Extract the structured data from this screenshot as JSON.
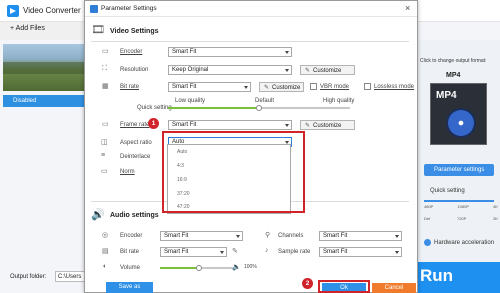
{
  "app": {
    "title": "Video Converter",
    "add_files": "+ Add Files",
    "track": "Disabled",
    "output_folder_label": "Output folder:",
    "output_path": "C:\\Users",
    "right_panel": {
      "hint": "Click to change output format:",
      "format": "MP4",
      "tile_label": "MP4",
      "param_button": "Parameter settings",
      "quick_setting": "Quick setting",
      "ticks_top": [
        "480P",
        "1080P",
        "4K"
      ],
      "ticks_bottom": [
        "Def",
        "720P",
        "2K"
      ],
      "hw_accel": "Hardware acceleration",
      "run": "Run"
    }
  },
  "dialog": {
    "title": "Parameter Settings",
    "close": "×",
    "video": {
      "section_title": "Video Settings",
      "encoder_label": "Encoder",
      "encoder_value": "Smart Fit",
      "resolution_label": "Resolution",
      "resolution_value": "Keep Original",
      "customize": "Customize",
      "bitrate_label": "Bit rate",
      "bitrate_value": "Smart Fit",
      "vbr_label": "VBR mode",
      "lossless_label": "Lossless mode",
      "quick_label": "Quick setting",
      "quality_low": "Low quality",
      "quality_default": "Default",
      "quality_high": "High quality",
      "framerate_label": "Frame rate",
      "framerate_value": "Smart Fit",
      "aspect_label": "Aspect ratio",
      "aspect_value": "Auto",
      "deinterlace_label": "Deinterlace",
      "norm_label": "Norm",
      "aspect_options": [
        "Auto",
        "4:3",
        "16:9",
        "37:20",
        "47:20"
      ]
    },
    "audio": {
      "section_title": "Audio settings",
      "encoder_label": "Encoder",
      "encoder_value": "Smart Fit",
      "channels_label": "Channels",
      "channels_value": "Smart Fit",
      "bitrate_label": "Bit rate",
      "bitrate_value": "Smart Fit",
      "samplerate_label": "Sample rate",
      "samplerate_value": "Smart Fit",
      "volume_label": "Volume",
      "volume_value": "100%",
      "volume_level": 0.5
    },
    "save_as": "Save as",
    "ok": "Ok",
    "cancel": "Cancel",
    "badge_1": "1",
    "badge_2": "2"
  },
  "colors": {
    "accent": "#2e90e6",
    "highlight": "#d0232a",
    "cancel": "#f07b2c",
    "slider": "#7bbf3a"
  }
}
